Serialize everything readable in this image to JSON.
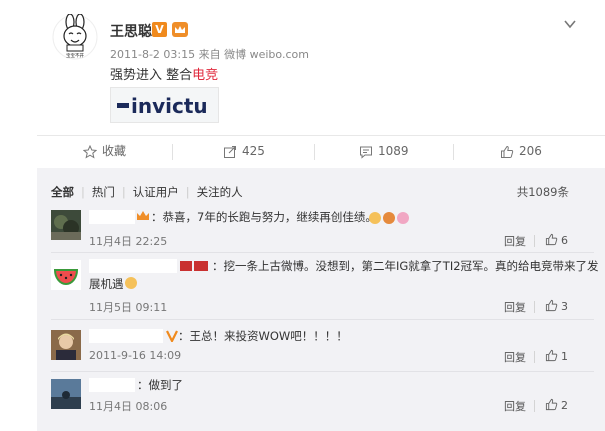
{
  "post": {
    "author": "王思聪",
    "verified_badge": "V",
    "meta": "2011-8-2 03:15 来自 微博 weibo.com",
    "text_before": "强势进入 整合",
    "text_highlight": "电竞",
    "link_card_text": "invictu",
    "avatar_caption": "宝宝不开"
  },
  "actions": {
    "favorite": "收藏",
    "repost": "425",
    "comment": "1089",
    "like": "206"
  },
  "comments_section": {
    "tabs": [
      "全部",
      "热门",
      "认证用户",
      "关注的人"
    ],
    "total": "共1089条",
    "items": [
      {
        "text": "：恭喜，7年的长跑与努力，继续再创佳绩。",
        "time": "11月4日 22:25",
        "reply": "回复",
        "likes": "6"
      },
      {
        "text_line1": "：挖一条上古微博。没想到，第二年IG就拿了TI2冠军。真的给电竞带来了发",
        "text_line2": "展机遇",
        "time": "11月5日 09:11",
        "reply": "回复",
        "likes": "3"
      },
      {
        "text": "：王总！来投资WOW吧！！！！",
        "time": "2011-9-16 14:09",
        "reply": "回复",
        "likes": "1"
      },
      {
        "text": "：做到了",
        "time": "11月4日 08:06",
        "reply": "回复",
        "likes": "2"
      }
    ]
  },
  "colors": {
    "accent_red": "#e0283c",
    "verified_orange": "#f08a1d",
    "panel_bg": "#f2f2f5"
  }
}
